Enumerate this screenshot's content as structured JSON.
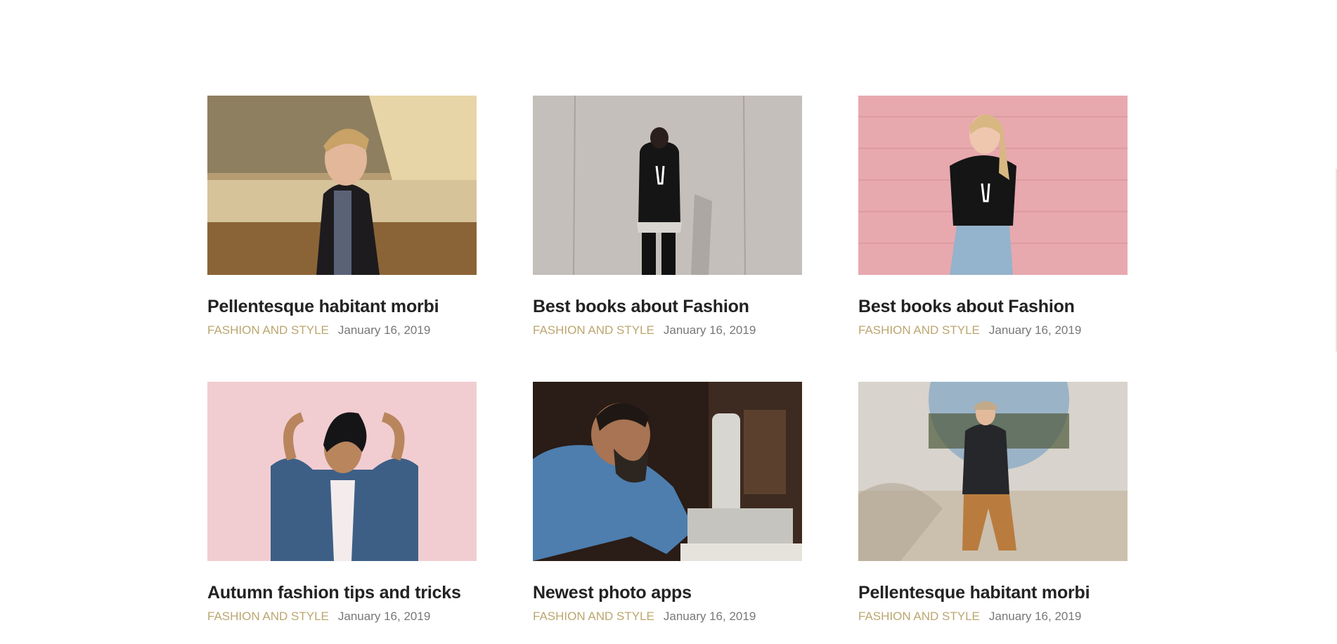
{
  "posts": [
    {
      "title": "Pellentesque habitant morbi",
      "category": "FASHION AND STYLE",
      "date": "January 16, 2019",
      "image": "man-leather-jacket-photo"
    },
    {
      "title": "Best books about Fashion",
      "category": "FASHION AND STYLE",
      "date": "January 16, 2019",
      "image": "man-concrete-wall-photo"
    },
    {
      "title": "Best books about Fashion",
      "category": "FASHION AND STYLE",
      "date": "January 16, 2019",
      "image": "woman-pink-wall-photo"
    },
    {
      "title": "Autumn fashion tips and tricks",
      "category": "FASHION AND STYLE",
      "date": "January 16, 2019",
      "image": "woman-denim-jacket-photo"
    },
    {
      "title": "Newest photo apps",
      "category": "FASHION AND STYLE",
      "date": "January 16, 2019",
      "image": "man-sewing-machine-photo"
    },
    {
      "title": "Pellentesque habitant morbi",
      "category": "FASHION AND STYLE",
      "date": "January 16, 2019",
      "image": "man-sitting-wall-photo"
    }
  ],
  "colors": {
    "category": "#bca66f",
    "title": "#222222",
    "date": "#777777"
  }
}
